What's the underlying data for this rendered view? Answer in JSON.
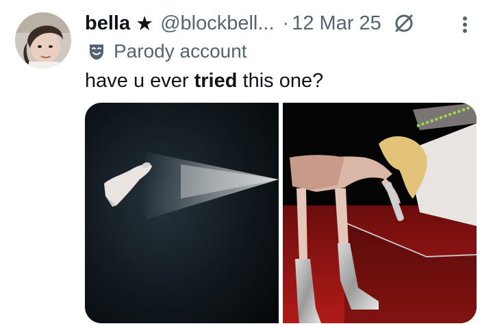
{
  "author": {
    "display_name": "bella",
    "star": "★",
    "handle": "@blockbell...",
    "separator": "·",
    "date": "12 Mar 25",
    "label": "Parody account",
    "avatar_icon": "avatar",
    "mask_icon": "theatre-mask-icon",
    "modified_icon": "no-symbol-icon",
    "more_icon": "more-vertical-icon"
  },
  "tweet": {
    "text_before": "have u ever ",
    "text_bold": "tried",
    "text_after": " this one?"
  },
  "media": {
    "count": 2,
    "images": [
      "floating-figure-spotlight-photo",
      "singer-silver-boots-stage-photo"
    ]
  },
  "colors": {
    "primary_text": "#0f1419",
    "secondary_text": "#536471"
  }
}
